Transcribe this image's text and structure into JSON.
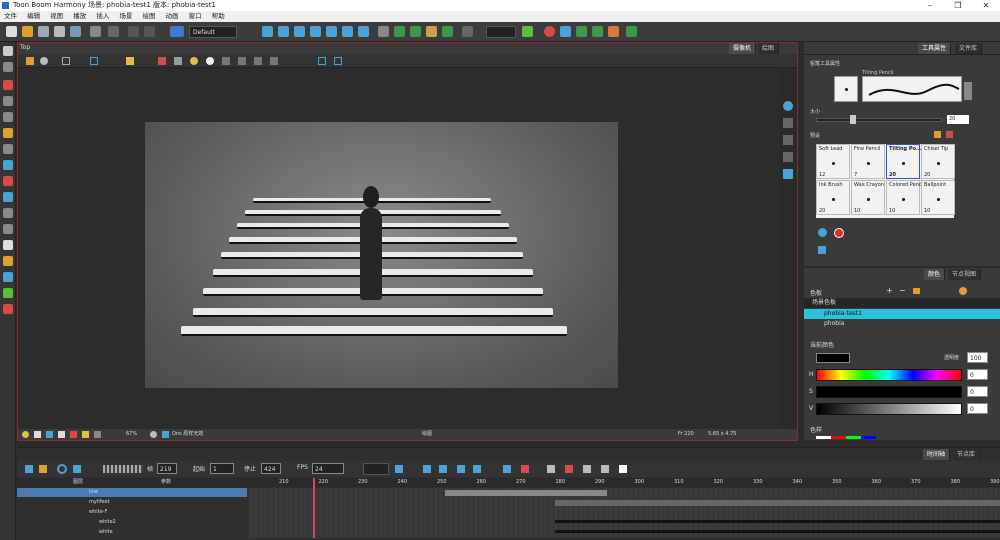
{
  "window": {
    "title": "Toon Boom Harmony 场景: phobia-test1 版本: phobia-test1"
  },
  "menu": [
    "文件",
    "编辑",
    "视图",
    "播放",
    "插入",
    "场景",
    "绘图",
    "动画",
    "窗口",
    "帮助"
  ],
  "toolbar": {
    "workspace": "Default"
  },
  "camera": {
    "tabs": {
      "camera": "摄像机",
      "drawing": "绘图"
    },
    "view_label": "Top",
    "zoom": "67%",
    "status_mode": "绘图",
    "status_frame": "Fr 220",
    "status_coords": "5.65 x 4.75",
    "status_settings": "Ons 原样无效"
  },
  "tool_props": {
    "tabs": {
      "tool": "工具属性",
      "library": "文件库"
    },
    "section": "铅笔工具属性",
    "preset_name": "Tilting Pencil",
    "size_label": "大小",
    "size_value": "20",
    "style_label": "预设",
    "brushes": [
      {
        "name": "Soft Lead",
        "size": "12"
      },
      {
        "name": "Fine Pencil",
        "size": "7"
      },
      {
        "name": "Tilting Po...",
        "size": "20"
      },
      {
        "name": "Chisel Tip",
        "size": "20"
      },
      {
        "name": "Ink Brush",
        "size": "20"
      },
      {
        "name": "Wax Crayon",
        "size": "10"
      },
      {
        "name": "Colored Pencil",
        "size": "10"
      },
      {
        "name": "Ballpoint",
        "size": "10"
      }
    ]
  },
  "color": {
    "tabs": {
      "color": "颜色",
      "node": "节点视图"
    },
    "palette_header": "色板",
    "scene_palette": "场景色板",
    "palettes": [
      "phobia-test1",
      "phobia"
    ],
    "selected_palette": "phobia-test1",
    "current_color": "当前颜色",
    "opacity_label": "透明度",
    "opacity_value": "100",
    "h_label": "H",
    "h_value": "0",
    "s_label": "S",
    "s_value": "0",
    "v_label": "V",
    "v_value": "0",
    "swatches_label": "色样",
    "accent": "#29c4dc"
  },
  "timeline": {
    "tabs": {
      "timeline": "时间轴",
      "node": "节点库"
    },
    "frame": "219",
    "start_label": "起始",
    "start": "1",
    "end_label": "停止",
    "end": "424",
    "fps_label": "FPS",
    "fps": "24",
    "frame_label": "帧",
    "layers_header": "图层",
    "params_header": "参数",
    "layers": [
      "line",
      "mylifeet",
      "white-F",
      "white2",
      "white"
    ],
    "ruler": [
      "210",
      "220",
      "230",
      "240",
      "250",
      "260",
      "270",
      "280",
      "290",
      "300",
      "310",
      "320",
      "330",
      "340",
      "350",
      "360",
      "370",
      "380",
      "390"
    ]
  }
}
